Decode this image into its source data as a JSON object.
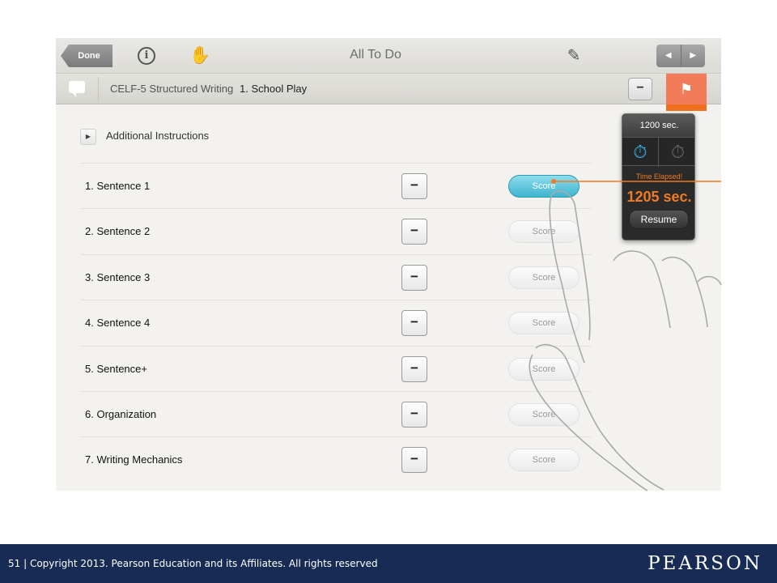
{
  "toolbar": {
    "done_label": "Done",
    "title": "All To Do",
    "prev_label": "◀",
    "next_label": "▶"
  },
  "subheader": {
    "crumb": "CELF-5 Structured Writing",
    "item_title": "1. School Play",
    "collapse_label": "−",
    "flag_label": "⚑"
  },
  "content": {
    "additional_instructions": "Additional Instructions",
    "score_label": "Score",
    "minus_label": "−",
    "rows": [
      {
        "label": "1. Sentence 1",
        "active": true
      },
      {
        "label": "2. Sentence 2",
        "active": false
      },
      {
        "label": "3. Sentence 3",
        "active": false
      },
      {
        "label": "4. Sentence 4",
        "active": false
      },
      {
        "label": "5. Sentence+",
        "active": false
      },
      {
        "label": "6. Organization",
        "active": false
      },
      {
        "label": "7. Writing Mechanics",
        "active": false
      }
    ]
  },
  "timer": {
    "limit": "1200 sec.",
    "status": "Time Elapsed!",
    "elapsed": "1205 sec.",
    "resume_label": "Resume"
  },
  "icons": {
    "info": "info-icon",
    "hand": "hand-raise-icon",
    "pencil": "pencil-icon",
    "comment": "comment-icon",
    "flag": "flag-icon",
    "stopwatch_up": "stopwatch-up-icon",
    "stopwatch_down": "stopwatch-down-icon"
  },
  "colors": {
    "accent_score": "#3fb5cf",
    "timer_alert": "#f07b21",
    "flag": "#f27c5a",
    "footer": "#182b54"
  },
  "footer": {
    "copyright": "51  | Copyright 2013. Pearson Education and its Affiliates. All rights reserved",
    "brand": "PEARSON"
  }
}
